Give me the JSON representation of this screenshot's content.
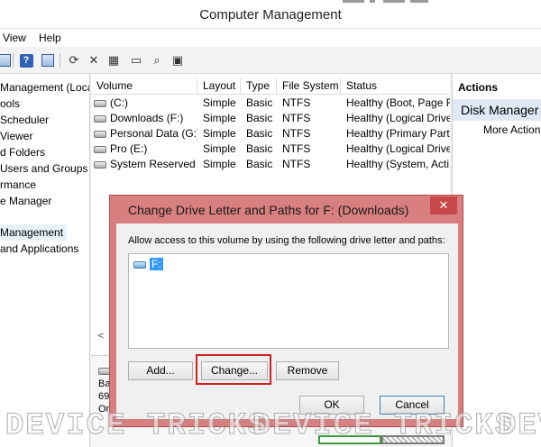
{
  "window": {
    "title": "Computer Management"
  },
  "menu": [
    "View",
    "Help"
  ],
  "toolbar_icons": [
    "panel-icon",
    "help-icon",
    "panel-icon",
    "refresh-icon",
    "delete-icon",
    "properties-icon",
    "open-folder-icon",
    "search-icon",
    "settings-icon"
  ],
  "tree": {
    "items": [
      "Management (Local",
      "ools",
      "Scheduler",
      " Viewer",
      "d Folders",
      " Users and Groups",
      "rmance",
      "e Manager",
      "Management",
      "and Applications"
    ]
  },
  "table": {
    "columns": [
      "Volume",
      "Layout",
      "Type",
      "File System",
      "Status"
    ],
    "rows": [
      [
        "(C:)",
        "Simple",
        "Basic",
        "NTFS",
        "Healthy (Boot, Page F"
      ],
      [
        "Downloads (F:)",
        "Simple",
        "Basic",
        "NTFS",
        "Healthy (Logical Drive"
      ],
      [
        "Personal Data (G:)",
        "Simple",
        "Basic",
        "NTFS",
        "Healthy (Primary Part"
      ],
      [
        "Pro (E:)",
        "Simple",
        "Basic",
        "NTFS",
        "Healthy (Logical Drive"
      ],
      [
        "System Reserved",
        "Simple",
        "Basic",
        "NTFS",
        "Healthy (System, Acti"
      ]
    ]
  },
  "graphical": {
    "disk_label_1": "Ba",
    "disk_label_2": "69",
    "disk_label_3": "Or"
  },
  "actions": {
    "header": "Actions",
    "section": "Disk Manager",
    "more": "More Action"
  },
  "dialog": {
    "title": "Change Drive Letter and Paths for F: (Downloads)",
    "close_label": "✕",
    "instruction": "Allow access to this volume by using the following drive letter and paths:",
    "items": [
      "F:"
    ],
    "add_label": "Add...",
    "change_label": "Change...",
    "remove_label": "Remove",
    "ok_label": "OK",
    "cancel_label": "Cancel"
  },
  "watermark": {
    "text": "DEVICE TRICKS",
    "partial": "DEV"
  },
  "colors": {
    "accent": "#3399ff",
    "dialog_frame": "#d87f7f",
    "highlight": "#d21f1f"
  }
}
